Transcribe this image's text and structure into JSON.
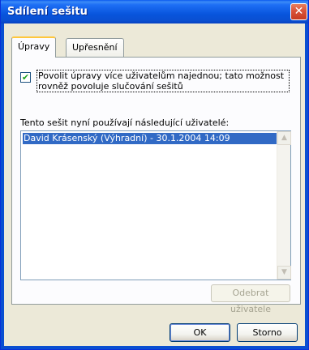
{
  "window": {
    "title": "Sdílení sešitu",
    "close_glyph": "✕"
  },
  "tabs": [
    {
      "label": "Úpravy",
      "active": true
    },
    {
      "label": "Upřesnění",
      "active": false
    }
  ],
  "editing": {
    "allow_multiuser": {
      "checked": true,
      "check_glyph": "✔",
      "label": "Povolit úpravy více uživatelům najednou; tato možnost rovněž povoluje slučování sešitů"
    },
    "users_label": "Tento sešit nyní používají následující uživatelé:",
    "users": [
      "David Krásenský (Výhradní) - 30.1.2004 14:09"
    ],
    "scroll_up_glyph": "▲",
    "scroll_down_glyph": "▼",
    "remove_user_label": "Odebrat uživatele"
  },
  "buttons": {
    "ok_label": "OK",
    "cancel_label": "Storno"
  },
  "colors": {
    "titlebar": "#0a4fd1",
    "selection": "#316ac5",
    "dialog_bg": "#ece9d8",
    "close_button": "#d9533a"
  }
}
